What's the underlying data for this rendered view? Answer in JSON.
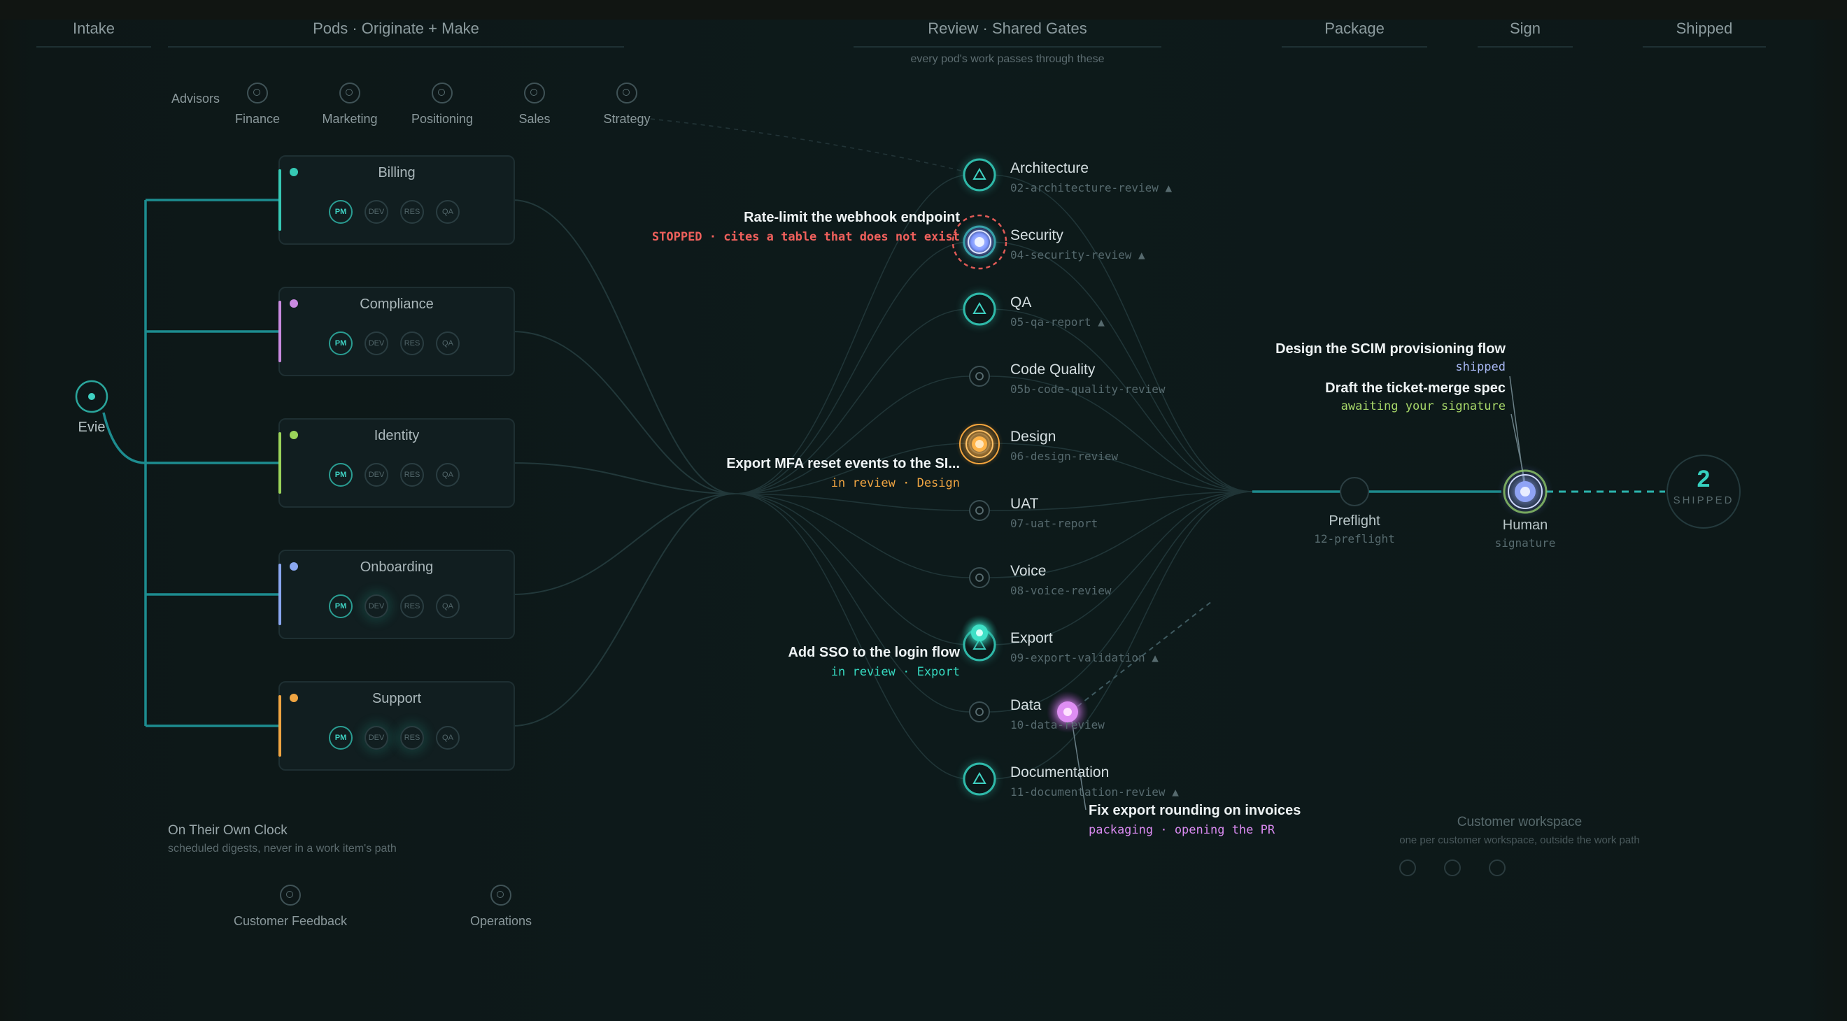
{
  "stages": {
    "intake": "Intake",
    "pods": "Pods · Originate + Make",
    "review": "Review · Shared Gates",
    "review_sub": "every pod's work passes through these",
    "package": "Package",
    "sign": "Sign",
    "shipped": "Shipped"
  },
  "advisors": {
    "label": "Advisors",
    "items": [
      "Finance",
      "Marketing",
      "Positioning",
      "Sales",
      "Strategy"
    ]
  },
  "intake_node": {
    "label": "Evie"
  },
  "pods": [
    {
      "name": "Billing",
      "color": "#36c9b4",
      "roles": [
        "PM",
        "DEV",
        "RES",
        "QA"
      ]
    },
    {
      "name": "Compliance",
      "color": "#c98ae0",
      "roles": [
        "PM",
        "DEV",
        "RES",
        "QA"
      ]
    },
    {
      "name": "Identity",
      "color": "#9bd45a",
      "roles": [
        "PM",
        "DEV",
        "RES",
        "QA"
      ]
    },
    {
      "name": "Onboarding",
      "color": "#8aa7f0",
      "roles": [
        "PM",
        "DEV",
        "RES",
        "QA"
      ]
    },
    {
      "name": "Support",
      "color": "#f0a542",
      "roles": [
        "PM",
        "DEV",
        "RES",
        "QA"
      ]
    }
  ],
  "gates": [
    {
      "name": "Architecture",
      "file": "02-architecture-review ▲",
      "icon": "triangle-icon"
    },
    {
      "name": "Security",
      "file": "04-security-review ▲",
      "icon": "triangle-icon"
    },
    {
      "name": "QA",
      "file": "05-qa-report ▲",
      "icon": "triangle-icon"
    },
    {
      "name": "Code Quality",
      "file": "05b-code-quality-review",
      "icon": "ring-icon"
    },
    {
      "name": "Design",
      "file": "06-design-review",
      "icon": "ring-icon"
    },
    {
      "name": "UAT",
      "file": "07-uat-report",
      "icon": "ring-icon"
    },
    {
      "name": "Voice",
      "file": "08-voice-review",
      "icon": "ring-icon"
    },
    {
      "name": "Export",
      "file": "09-export-validation ▲",
      "icon": "triangle-icon"
    },
    {
      "name": "Data",
      "file": "10-data-review",
      "icon": "ring-icon"
    },
    {
      "name": "Documentation",
      "file": "11-documentation-review ▲",
      "icon": "triangle-icon"
    }
  ],
  "callouts": {
    "security": {
      "title": "Rate-limit the webhook endpoint",
      "status": "STOPPED · cites a table that does not exist",
      "color": "#f0605c"
    },
    "design": {
      "title": "Export MFA reset events to the SI...",
      "status": "in review · Design",
      "color": "#f0a542"
    },
    "export": {
      "title": "Add SSO to the login flow",
      "status": "in review · Export",
      "color": "#36d9c0"
    },
    "data": {
      "title": "Fix export rounding on invoices",
      "status": "packaging · opening the PR",
      "color": "#d98af0"
    },
    "scim": {
      "title": "Design the SCIM provisioning flow",
      "status": "shipped",
      "color": "#a9b9f5"
    },
    "ticket": {
      "title": "Draft the ticket-merge spec",
      "status": "awaiting your signature",
      "color": "#a9d96a"
    }
  },
  "package": {
    "label": "Preflight",
    "file": "12-preflight"
  },
  "sign": {
    "label": "Human",
    "sub": "signature"
  },
  "shipped": {
    "count": "2",
    "label": "SHIPPED"
  },
  "own_clock": {
    "title": "On Their Own Clock",
    "sub": "scheduled digests, never in a work item's path",
    "items": [
      "Customer Feedback",
      "Operations"
    ]
  },
  "workspace": {
    "title": "Customer workspace",
    "sub": "one per customer workspace, outside the work path"
  },
  "colors": {
    "accent": "#2a9d92",
    "wire": "#1f8a8c",
    "security_orb": "#9fb2ff",
    "design_orb": "#f0a542",
    "export_orb": "#36d9c0",
    "data_orb": "#d98af0",
    "human_orb": "#a9b9f5"
  }
}
